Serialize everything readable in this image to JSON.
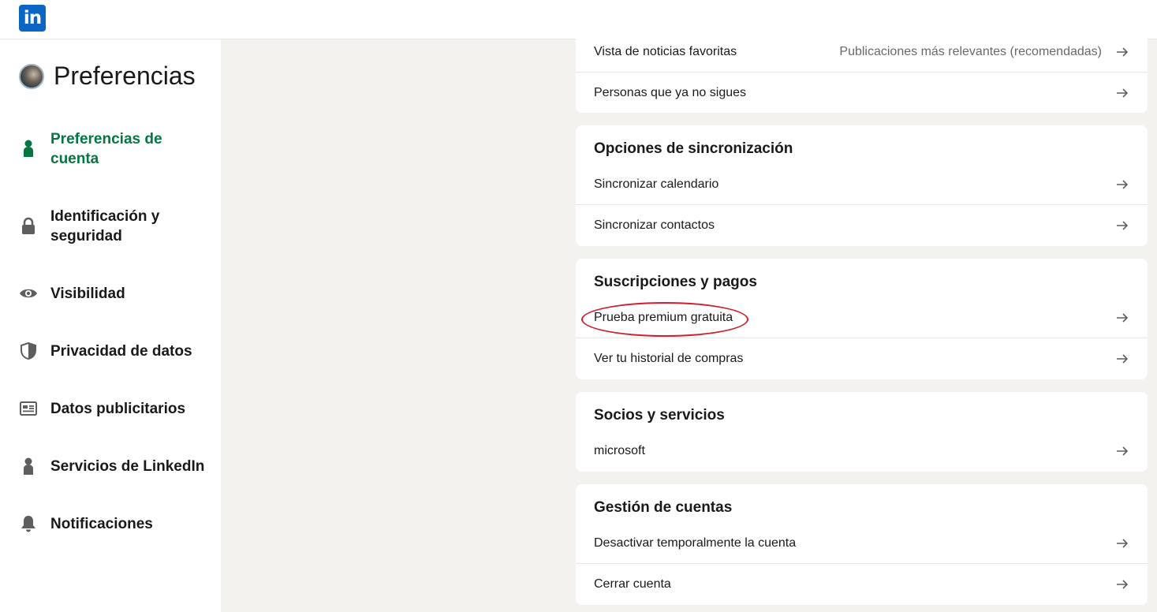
{
  "logo": {
    "text": "in"
  },
  "sidebar": {
    "title": "Preferencias",
    "items": [
      {
        "label": "Preferencias de cuenta",
        "icon": "person-icon"
      },
      {
        "label": "Identificación y seguridad",
        "icon": "lock-icon"
      },
      {
        "label": "Visibilidad",
        "icon": "eye-icon"
      },
      {
        "label": "Privacidad de datos",
        "icon": "shield-icon"
      },
      {
        "label": "Datos publicitarios",
        "icon": "newspaper-icon"
      },
      {
        "label": "Servicios de LinkedIn",
        "icon": "person-icon"
      },
      {
        "label": "Notificaciones",
        "icon": "bell-icon"
      }
    ]
  },
  "general": {
    "rows": [
      {
        "label": "Vista de noticias favoritas",
        "value": "Publicaciones más relevantes (recomendadas)"
      },
      {
        "label": "Personas que ya no sigues"
      }
    ]
  },
  "sync": {
    "title": "Opciones de sincronización",
    "rows": [
      {
        "label": "Sincronizar calendario"
      },
      {
        "label": "Sincronizar contactos"
      }
    ]
  },
  "subscriptions": {
    "title": "Suscripciones y pagos",
    "rows": [
      {
        "label": "Prueba premium gratuita"
      },
      {
        "label": "Ver tu historial de compras"
      }
    ]
  },
  "partners": {
    "title": "Socios y servicios",
    "rows": [
      {
        "label": "microsoft"
      }
    ]
  },
  "account": {
    "title": "Gestión de cuentas",
    "rows": [
      {
        "label": "Desactivar temporalmente la cuenta"
      },
      {
        "label": "Cerrar cuenta"
      }
    ]
  },
  "colors": {
    "accent": "#057642",
    "brand": "#0a66c2",
    "highlight": "#d0202e"
  }
}
